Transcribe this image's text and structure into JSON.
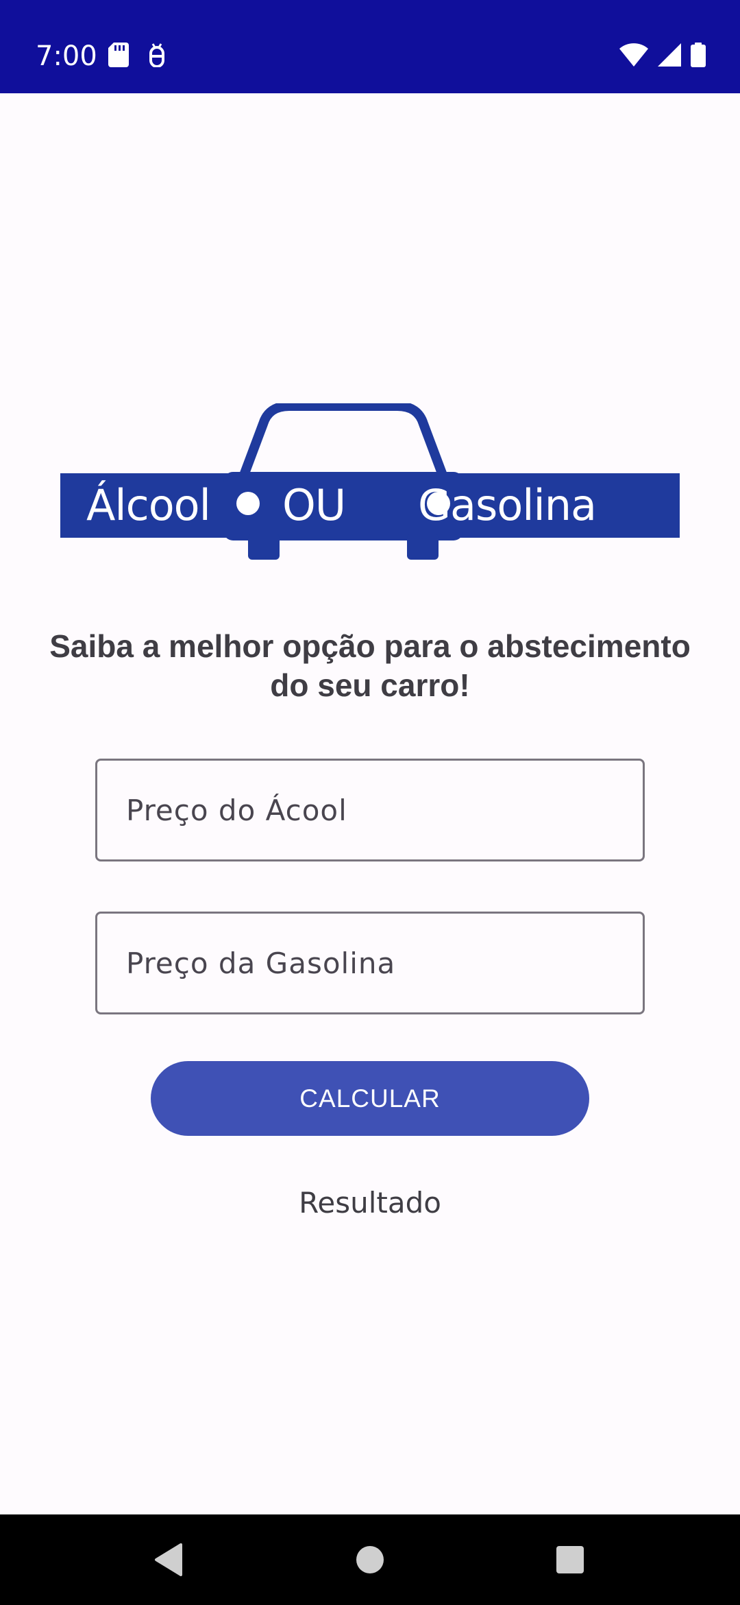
{
  "status_bar": {
    "time": "7:00",
    "icons_left": [
      "sd-card-icon",
      "android-debug-icon"
    ],
    "icons_right": [
      "wifi-icon",
      "cell-signal-icon",
      "battery-icon"
    ],
    "background": "#100f9b"
  },
  "logo": {
    "word_left": "Álcool",
    "word_middle": "OU",
    "word_right": "Gasolina",
    "color": "#1f3a9d"
  },
  "tagline": "Saiba a melhor opção para o abstecimento do seu carro!",
  "inputs": {
    "alcool": {
      "placeholder": "Preço do Ácool",
      "value": ""
    },
    "gasolina": {
      "placeholder": "Preço da Gasolina",
      "value": ""
    }
  },
  "calculate_button": {
    "label": "CALCULAR",
    "color": "#3f51b5"
  },
  "result_text": "Resultado",
  "nav_bar": {
    "buttons": [
      "back-icon",
      "home-icon",
      "recents-icon"
    ]
  }
}
